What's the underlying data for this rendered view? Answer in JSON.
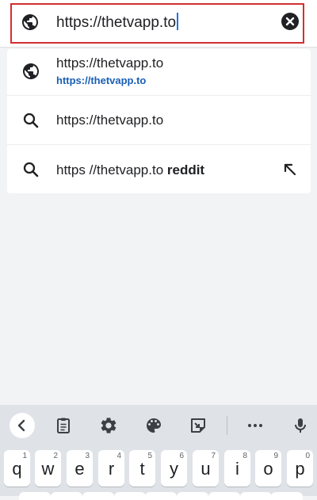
{
  "omnibox": {
    "value": "https://thetvapp.to"
  },
  "suggestions": [
    {
      "icon": "globe-icon",
      "title": "https://thetvapp.to",
      "subtitle": "https://thetvapp.to"
    },
    {
      "icon": "search-icon",
      "title": "https://thetvapp.to"
    },
    {
      "icon": "search-icon",
      "title_plain": "https //thetvapp.to ",
      "title_bold": "reddit",
      "action_icon": "arrow-up-left-icon"
    }
  ],
  "keyboard": {
    "toolbar_icons": [
      "chevron-left-icon",
      "clipboard-icon",
      "gear-icon",
      "palette-icon",
      "sticker-icon",
      "more-icon",
      "microphone-icon"
    ],
    "keys": [
      {
        "letter": "q",
        "num": "1"
      },
      {
        "letter": "w",
        "num": "2"
      },
      {
        "letter": "e",
        "num": "3"
      },
      {
        "letter": "r",
        "num": "4"
      },
      {
        "letter": "t",
        "num": "5"
      },
      {
        "letter": "y",
        "num": "6"
      },
      {
        "letter": "u",
        "num": "7"
      },
      {
        "letter": "i",
        "num": "8"
      },
      {
        "letter": "o",
        "num": "9"
      },
      {
        "letter": "p",
        "num": "0"
      }
    ]
  },
  "colors": {
    "highlight_border": "#d32f2f",
    "link_blue": "#1a5fb4",
    "cursor_blue": "#1a73e8",
    "keyboard_bg": "#dfe3e8"
  }
}
